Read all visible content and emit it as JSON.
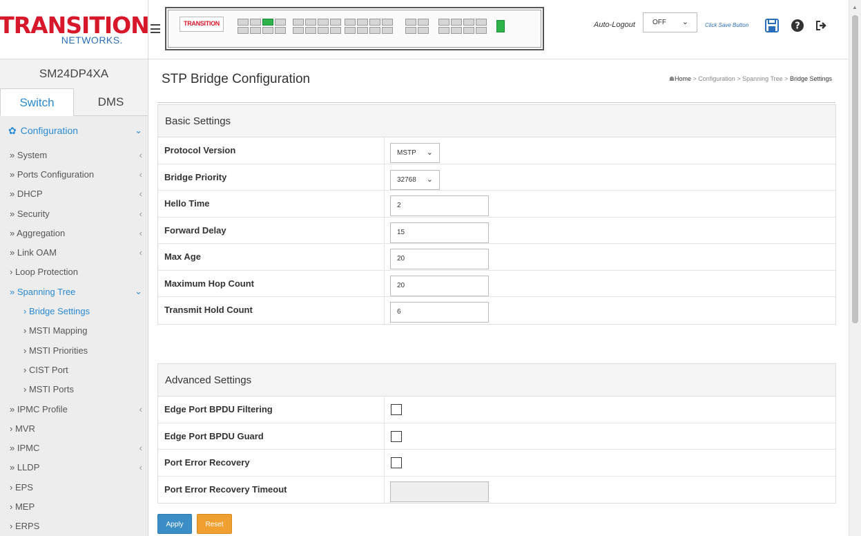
{
  "sidebar": {
    "logo_main": "TRANSITION",
    "logo_sub": "NETWORKS.",
    "model": "SM24DP4XA",
    "tabs": [
      {
        "label": "Switch",
        "active": true
      },
      {
        "label": "DMS",
        "active": false
      }
    ],
    "section_label": "Configuration",
    "items": [
      {
        "label": "» System",
        "arrow": "‹"
      },
      {
        "label": "» Ports Configuration",
        "arrow": "‹"
      },
      {
        "label": "» DHCP",
        "arrow": "‹"
      },
      {
        "label": "» Security",
        "arrow": "‹"
      },
      {
        "label": "» Aggregation",
        "arrow": "‹"
      },
      {
        "label": "» Link OAM",
        "arrow": "‹"
      },
      {
        "label": "› Loop Protection",
        "arrow": ""
      },
      {
        "label": "» Spanning Tree",
        "arrow": "⌄",
        "open": true
      },
      {
        "label": "› Bridge Settings",
        "arrow": "",
        "sub": true,
        "active": true
      },
      {
        "label": "› MSTI Mapping",
        "arrow": "",
        "sub": true
      },
      {
        "label": "› MSTI Priorities",
        "arrow": "",
        "sub": true
      },
      {
        "label": "› CIST Port",
        "arrow": "",
        "sub": true
      },
      {
        "label": "› MSTI Ports",
        "arrow": "",
        "sub": true
      },
      {
        "label": "» IPMC Profile",
        "arrow": "‹"
      },
      {
        "label": "› MVR",
        "arrow": ""
      },
      {
        "label": "» IPMC",
        "arrow": "‹"
      },
      {
        "label": "» LLDP",
        "arrow": "‹"
      },
      {
        "label": "› EPS",
        "arrow": ""
      },
      {
        "label": "› MEP",
        "arrow": ""
      },
      {
        "label": "› ERPS",
        "arrow": ""
      }
    ]
  },
  "header": {
    "panel_logo": "TRANSITION",
    "auto_logout_label": "Auto-Logout",
    "auto_logout_value": "OFF",
    "save_hint": "Click Save Button",
    "icons": [
      "save-icon",
      "help-icon",
      "logout-icon"
    ]
  },
  "page": {
    "title": "STP Bridge Configuration",
    "breadcrumb": {
      "home": "Home",
      "sep": ">",
      "items": [
        "Configuration",
        "Spanning Tree"
      ],
      "current": "Bridge Settings"
    }
  },
  "basic": {
    "heading": "Basic Settings",
    "protocol_version": {
      "label": "Protocol Version",
      "value": "MSTP"
    },
    "bridge_priority": {
      "label": "Bridge Priority",
      "value": "32768"
    },
    "hello_time": {
      "label": "Hello Time",
      "value": "2"
    },
    "forward_delay": {
      "label": "Forward Delay",
      "value": "15"
    },
    "max_age": {
      "label": "Max Age",
      "value": "20"
    },
    "max_hop_count": {
      "label": "Maximum Hop Count",
      "value": "20"
    },
    "tx_hold_count": {
      "label": "Transmit Hold Count",
      "value": "6"
    }
  },
  "advanced": {
    "heading": "Advanced Settings",
    "edge_bpdu_filtering": {
      "label": "Edge Port BPDU Filtering",
      "checked": false
    },
    "edge_bpdu_guard": {
      "label": "Edge Port BPDU Guard",
      "checked": false
    },
    "port_error_recovery": {
      "label": "Port Error Recovery",
      "checked": false
    },
    "port_error_recovery_timeout": {
      "label": "Port Error Recovery Timeout",
      "value": ""
    }
  },
  "buttons": {
    "apply": "Apply",
    "reset": "Reset"
  },
  "colors": {
    "accent": "#2a8ad4",
    "brand_red": "#d7182a",
    "apply": "#3b8dc5",
    "reset": "#f0a030"
  }
}
